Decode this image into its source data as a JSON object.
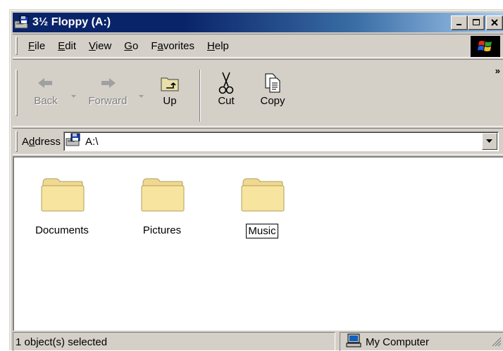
{
  "window": {
    "title": "3½ Floppy (A:)",
    "title_icon": "floppy-drive-icon",
    "controls": [
      "minimize-icon",
      "maximize-icon",
      "close-icon"
    ]
  },
  "menubar": {
    "items": [
      {
        "label": "File",
        "accel": "F",
        "rest": "ile"
      },
      {
        "label": "Edit",
        "accel": "E",
        "rest": "dit"
      },
      {
        "label": "View",
        "accel": "V",
        "rest": "iew"
      },
      {
        "label": "Go",
        "accel": "G",
        "rest": "o"
      },
      {
        "label": "Favorites",
        "accel_prefix": "F",
        "accel": "a",
        "rest": "vorites"
      },
      {
        "label": "Help",
        "accel": "H",
        "rest": "elp"
      }
    ],
    "logo_icon": "windows-logo-icon"
  },
  "toolbar": {
    "back_label": "Back",
    "forward_label": "Forward",
    "up_label": "Up",
    "cut_label": "Cut",
    "copy_label": "Copy",
    "more": "»"
  },
  "address": {
    "label_prefix": "A",
    "label_accel": "d",
    "label_rest": "dress",
    "value": "A:\\",
    "icon": "floppy-drive-icon"
  },
  "folders": [
    {
      "name": "Documents",
      "selected": false
    },
    {
      "name": "Pictures",
      "selected": false
    },
    {
      "name": "Music",
      "selected": true
    }
  ],
  "status": {
    "left_text": "1 object(s) selected",
    "right_text": "My Computer",
    "right_icon": "my-computer-icon"
  },
  "colors": {
    "titlebar_start": "#0a246a",
    "titlebar_end": "#a6caf0",
    "face": "#d4d0c8",
    "folder": "#f5dd88"
  }
}
